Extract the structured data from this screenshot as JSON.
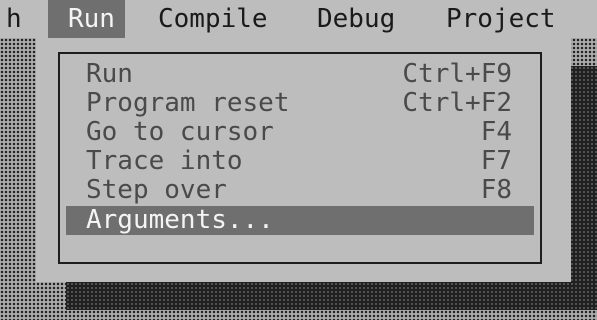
{
  "menubar": {
    "items": [
      {
        "label": "h"
      },
      {
        "label": "Run"
      },
      {
        "label": "Compile"
      },
      {
        "label": "Debug"
      },
      {
        "label": "Project"
      }
    ]
  },
  "run_menu": {
    "items": [
      {
        "label": "Run",
        "shortcut": "Ctrl+F9"
      },
      {
        "label": "Program reset",
        "shortcut": "Ctrl+F2"
      },
      {
        "label": "Go to cursor",
        "shortcut": "F4"
      },
      {
        "label": "Trace into",
        "shortcut": "F7"
      },
      {
        "label": "Step over",
        "shortcut": "F8"
      },
      {
        "label": "Arguments...",
        "shortcut": ""
      }
    ],
    "selected_label": "Arguments..."
  },
  "colors": {
    "menu_background": "#bdbdbd",
    "highlight": "#6f6f6f",
    "highlight_text": "#f4f4f4",
    "item_text": "#4a4a4a"
  }
}
